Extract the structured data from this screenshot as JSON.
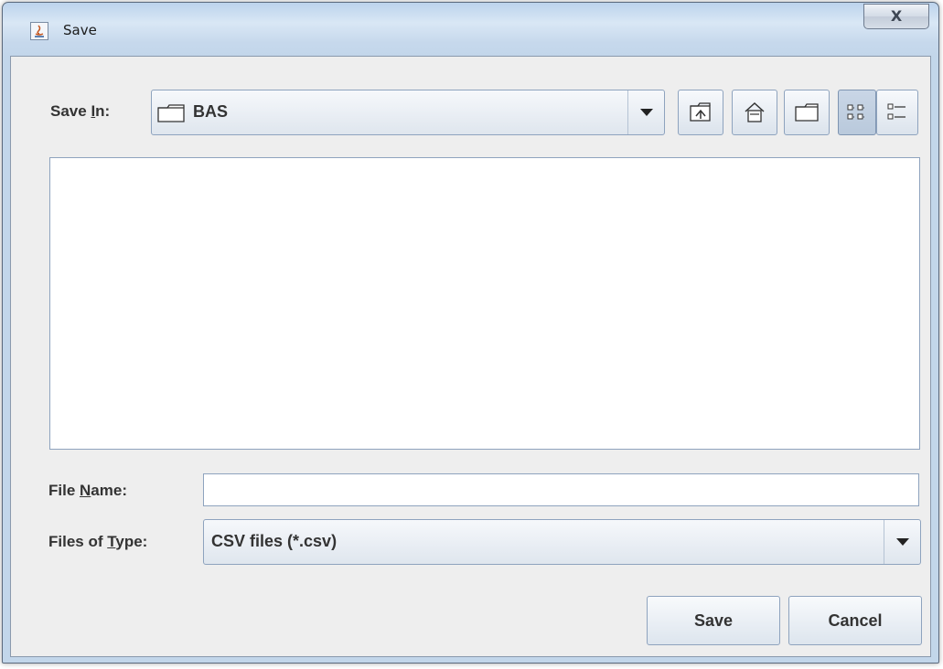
{
  "window": {
    "title": "Save",
    "close_glyph": "X"
  },
  "save_in": {
    "label_prefix": "Save ",
    "label_mnemonic": "I",
    "label_suffix": "n:",
    "value": "BAS",
    "icon": "folder-icon"
  },
  "toolbar": [
    {
      "name": "up-one-level-button",
      "icon": "folder-up-icon",
      "pressed": false
    },
    {
      "name": "home-button",
      "icon": "home-icon",
      "pressed": false
    },
    {
      "name": "create-new-folder-button",
      "icon": "new-folder-icon",
      "pressed": false
    },
    {
      "name": "list-view-button",
      "icon": "list-view-icon",
      "pressed": true
    },
    {
      "name": "details-view-button",
      "icon": "details-view-icon",
      "pressed": false
    }
  ],
  "file_name": {
    "label_prefix": "File ",
    "label_mnemonic": "N",
    "label_suffix": "ame:",
    "value": ""
  },
  "file_type": {
    "label_prefix": "Files of ",
    "label_mnemonic": "T",
    "label_suffix": "ype:",
    "value": "CSV files (*.csv)"
  },
  "buttons": {
    "save": "Save",
    "cancel": "Cancel"
  },
  "colors": {
    "border": "#8ea3be",
    "panel": "#eeeeee",
    "titlebar": "#c6d8ec"
  }
}
